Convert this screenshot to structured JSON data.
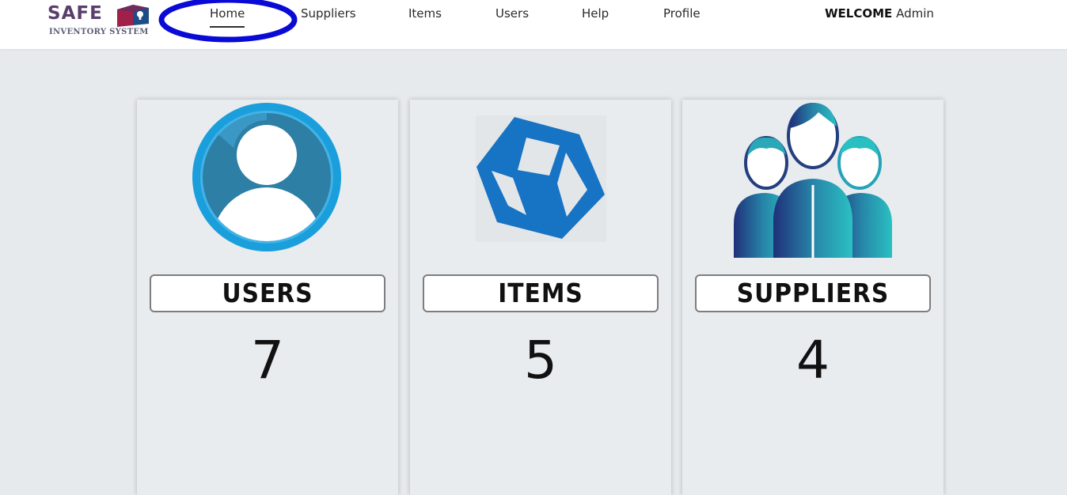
{
  "header": {
    "logo": {
      "title": "SAFE",
      "subtitle": "INVENTORY SYSTEM"
    },
    "nav": [
      {
        "label": "Home",
        "active": true
      },
      {
        "label": "Suppliers"
      },
      {
        "label": "Items"
      },
      {
        "label": "Users"
      },
      {
        "label": "Help"
      },
      {
        "label": "Profile"
      }
    ],
    "welcome": {
      "prefix": "WELCOME",
      "user": "Admin"
    }
  },
  "cards": [
    {
      "label": "USERS",
      "count": "7",
      "icon": "user-avatar-icon"
    },
    {
      "label": "ITEMS",
      "count": "5",
      "icon": "cube-icon"
    },
    {
      "label": "SUPPLIERS",
      "count": "4",
      "icon": "people-group-icon"
    }
  ],
  "colors": {
    "page_bg": "#e7eaed",
    "header_bg": "#ffffff",
    "highlight_ring": "#0a0ad6",
    "users_blue": "#1a9fdb",
    "items_blue": "#1a73c2",
    "suppliers_teal": "#2bb3c0"
  }
}
